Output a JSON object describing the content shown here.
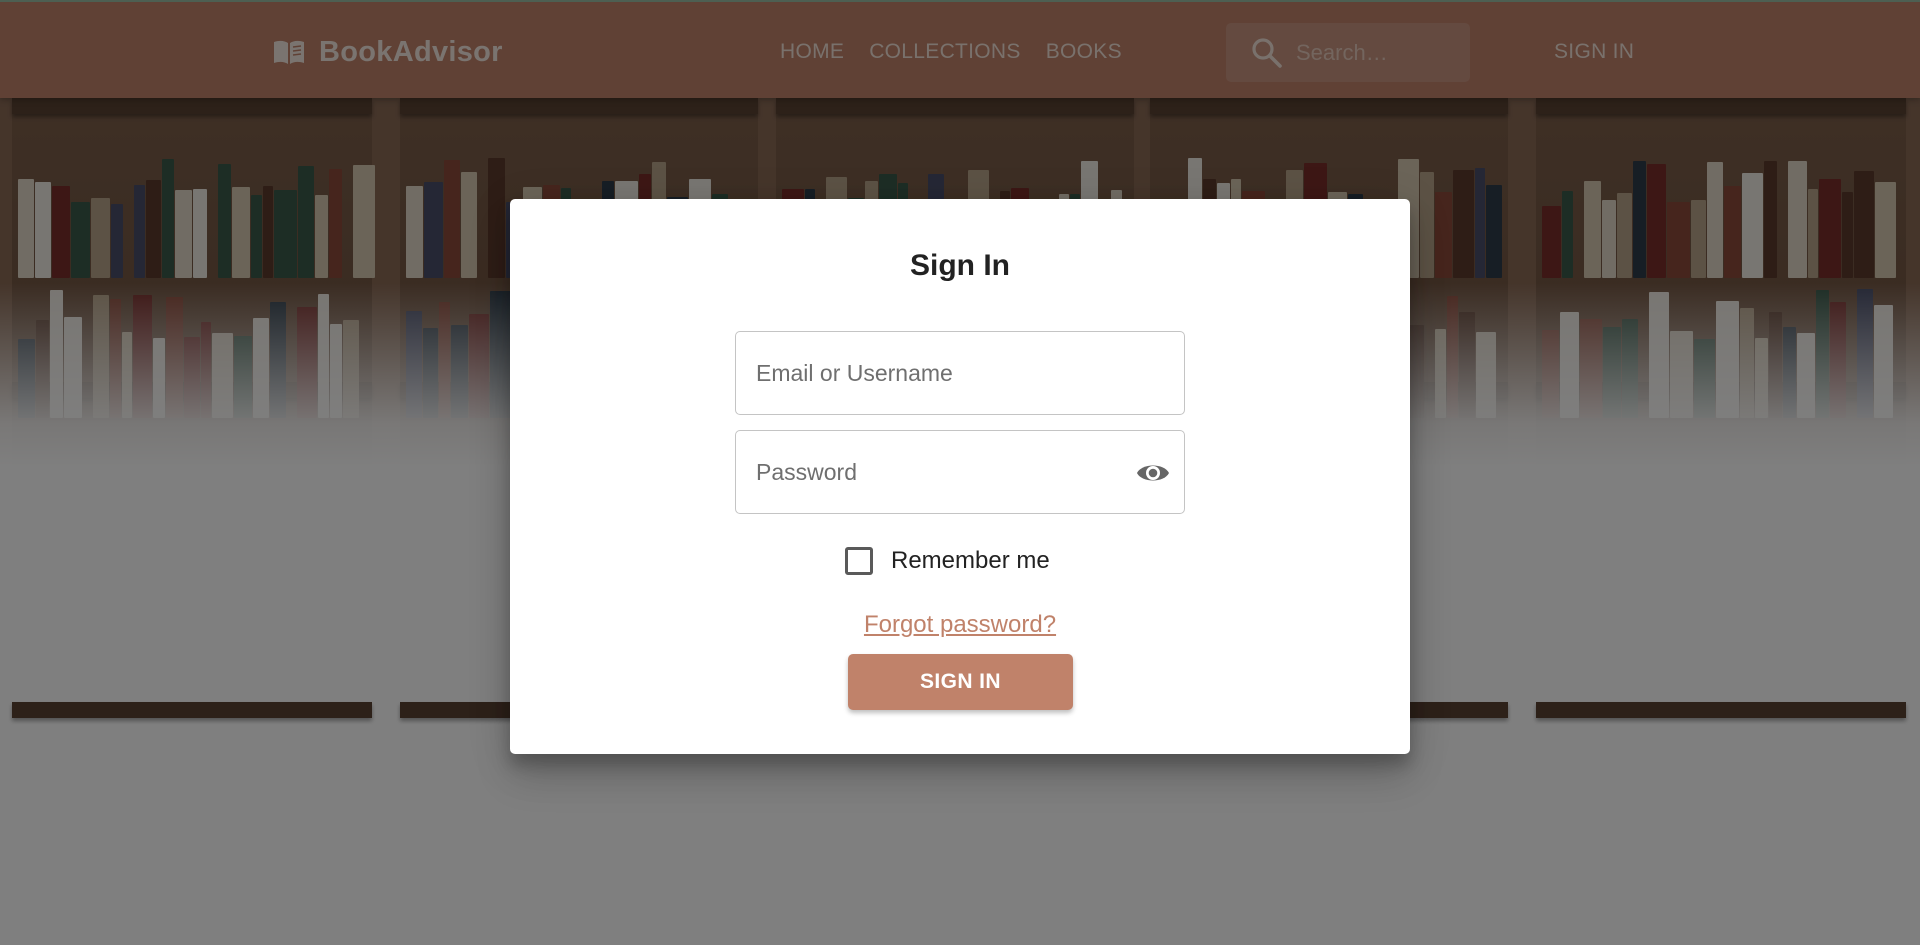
{
  "colors": {
    "brand": "#c0826a",
    "overlay": "rgba(0,0,0,0.5)",
    "dialog": "#ffffff"
  },
  "header": {
    "logo_icon": "book-open-icon",
    "brand_name": "BookAdvisor",
    "nav": [
      {
        "label": "HOME"
      },
      {
        "label": "COLLECTIONS"
      },
      {
        "label": "BOOKS"
      }
    ],
    "search": {
      "icon": "search-icon",
      "placeholder": "Search…"
    },
    "signin_label": "SIGN IN"
  },
  "dialog": {
    "title": "Sign In",
    "email": {
      "placeholder": "Email or Username",
      "value": ""
    },
    "password": {
      "placeholder": "Password",
      "value": "",
      "toggle_icon": "eye-icon"
    },
    "remember_label": "Remember me",
    "remember_checked": false,
    "forgot_label": "Forgot password?",
    "submit_label": "SIGN IN"
  }
}
